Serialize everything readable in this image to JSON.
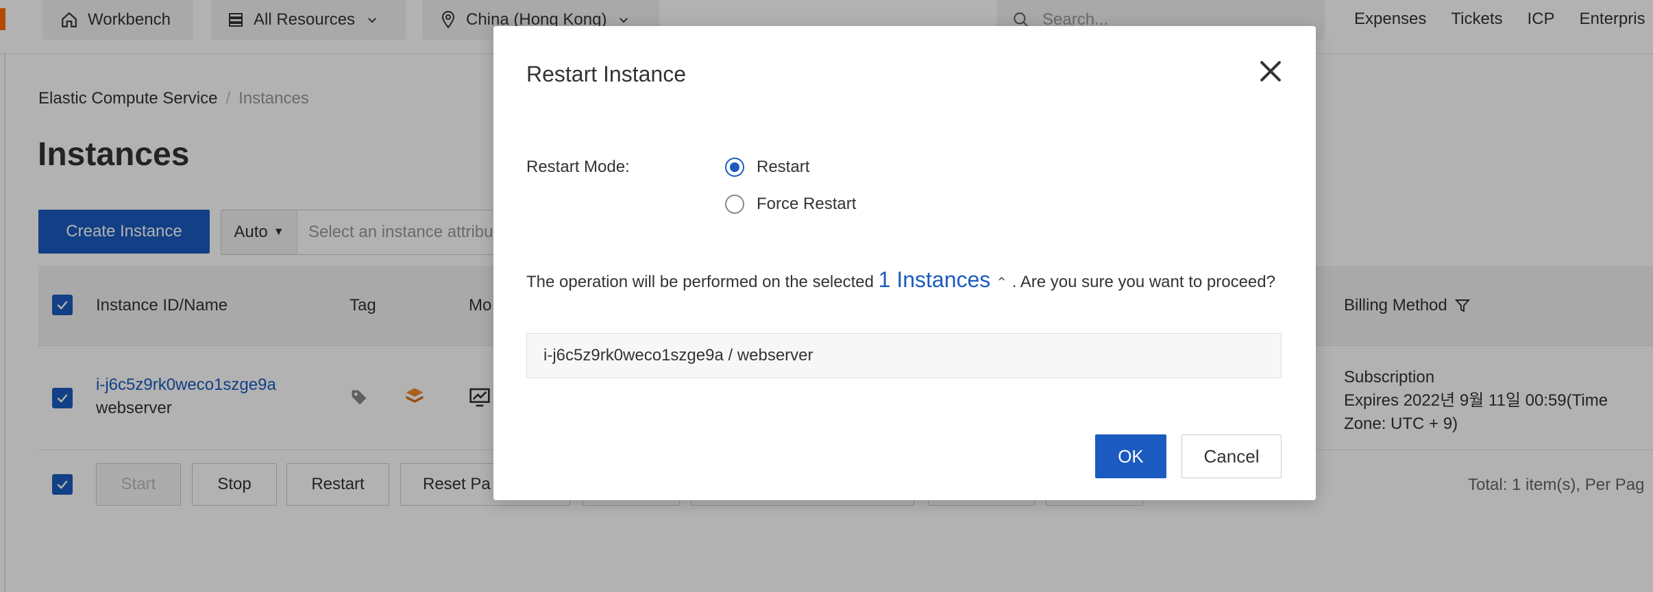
{
  "topbar": {
    "workbench": "Workbench",
    "resources": "All Resources",
    "region": "China (Hong Kong)",
    "search_placeholder": "Search...",
    "links": [
      "Expenses",
      "Tickets",
      "ICP",
      "Enterpris"
    ]
  },
  "breadcrumb": {
    "root": "Elastic Compute Service",
    "sep": "/",
    "current": "Instances"
  },
  "page": {
    "title": "Instances",
    "create_button": "Create Instance",
    "filter_mode": "Auto",
    "filter_placeholder": "Select an instance attribu"
  },
  "table": {
    "headers": {
      "id_name": "Instance ID/Name",
      "tag": "Tag",
      "monitoring": "Mo",
      "billing": "Billing Method"
    },
    "row": {
      "id": "i-j6c5z9rk0weco1szge9a",
      "name": "webserver",
      "billing_type": "Subscription",
      "billing_expiry": "Expires 2022년 9월 11일 00:59(Time Zone: UTC + 9)"
    }
  },
  "actions": {
    "start": "Start",
    "stop": "Stop",
    "restart": "Restart",
    "reset": "Reset Pa",
    "total": "Total: 1 item(s), Per Pag"
  },
  "dialog": {
    "title": "Restart Instance",
    "mode_label": "Restart Mode:",
    "option_restart": "Restart",
    "option_force": "Force Restart",
    "selected_mode": "Restart",
    "text_before": "The operation will be performed on the selected",
    "instances_link": "1 Instances",
    "text_after": ". Are you sure you want to proceed?",
    "selected_instance": "i-j6c5z9rk0weco1szge9a / webserver",
    "ok_label": "OK",
    "cancel_label": "Cancel"
  },
  "colors": {
    "primary": "#1b5bbf",
    "brand": "#ff6a00",
    "mask": "rgba(0,0,0,0.30)"
  }
}
